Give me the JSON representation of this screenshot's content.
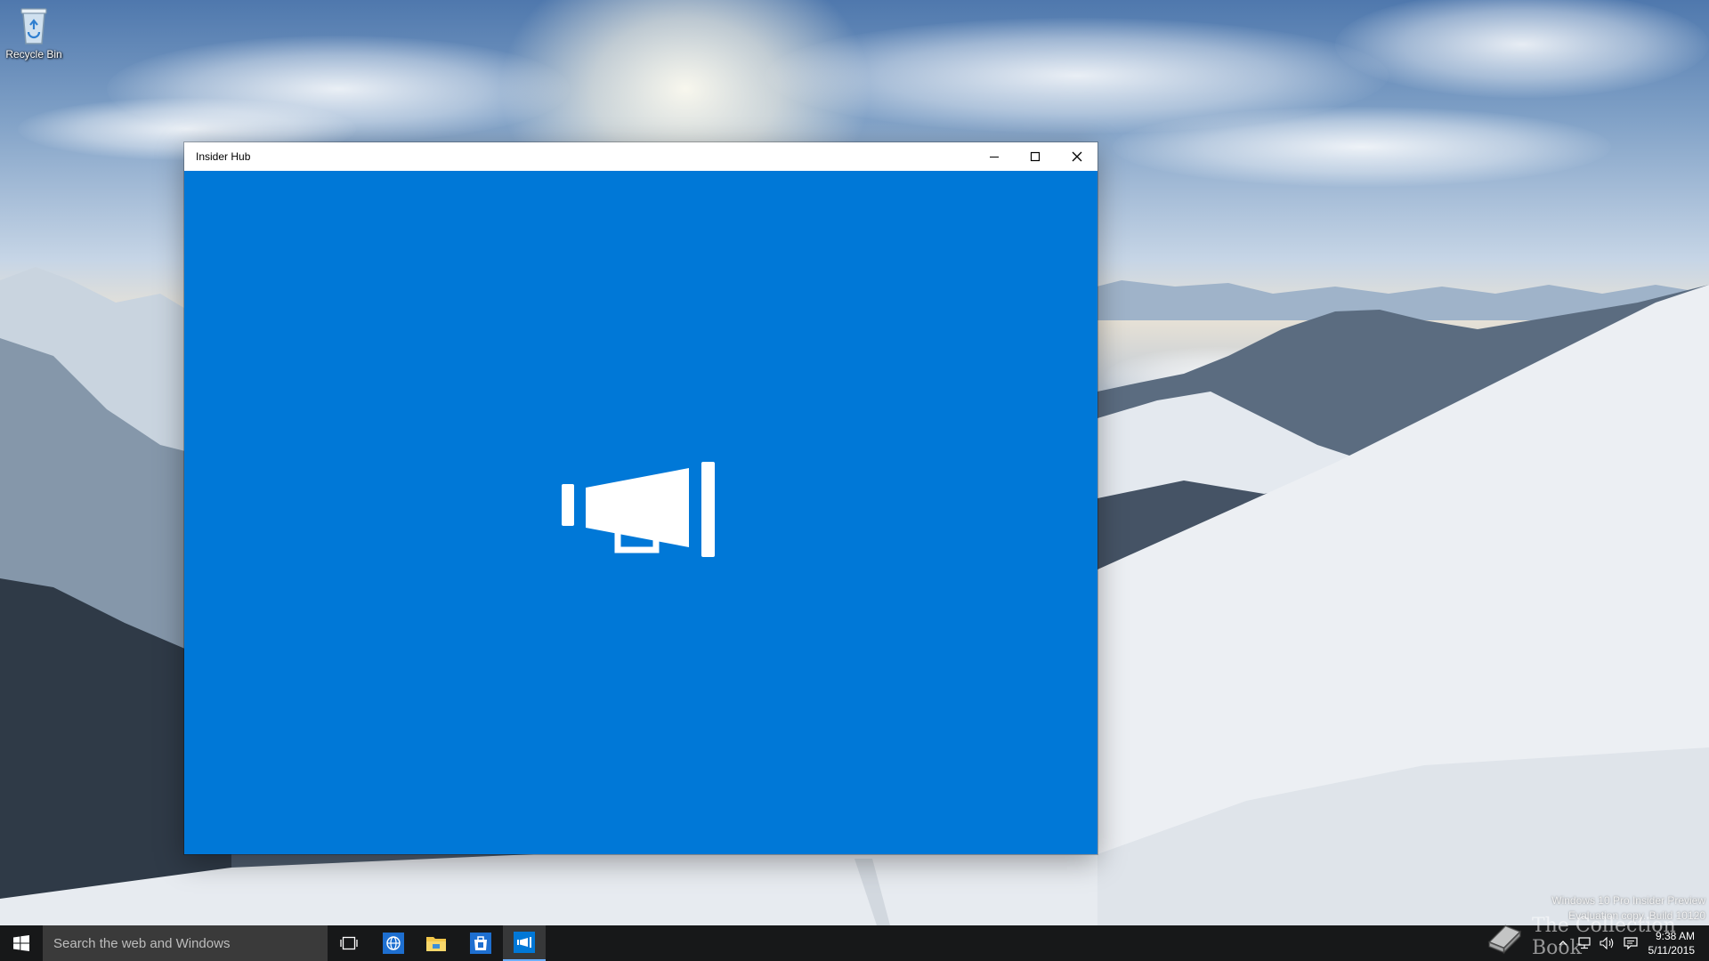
{
  "desktop": {
    "icons": [
      {
        "label": "Recycle Bin",
        "icon": "recycle-bin-icon"
      }
    ],
    "watermark": {
      "line1": "Windows 10 Pro Insider Preview",
      "line2": "Evaluation copy. Build 10120"
    }
  },
  "window": {
    "title": "Insider Hub",
    "controls": {
      "minimize": "minimize-icon",
      "maximize": "maximize-icon",
      "close": "close-icon"
    },
    "background_color": "#0078d7",
    "splash_icon": "megaphone-icon"
  },
  "taskbar": {
    "start_icon": "windows-logo-icon",
    "search_placeholder": "Search the web and Windows",
    "pinned": [
      {
        "name": "task-view",
        "icon": "task-view-icon"
      },
      {
        "name": "browser",
        "icon": "globe-icon"
      },
      {
        "name": "file-explorer",
        "icon": "folder-icon"
      },
      {
        "name": "store",
        "icon": "store-bag-icon"
      },
      {
        "name": "insider-hub",
        "icon": "megaphone-icon",
        "active": true
      }
    ],
    "tray": {
      "icons": [
        "chevron-up-icon",
        "network-icon",
        "volume-icon",
        "notification-icon"
      ],
      "time": "9:38 AM",
      "date": "5/11/2015"
    }
  },
  "overlay": {
    "brand_text": "The Collection Book"
  }
}
